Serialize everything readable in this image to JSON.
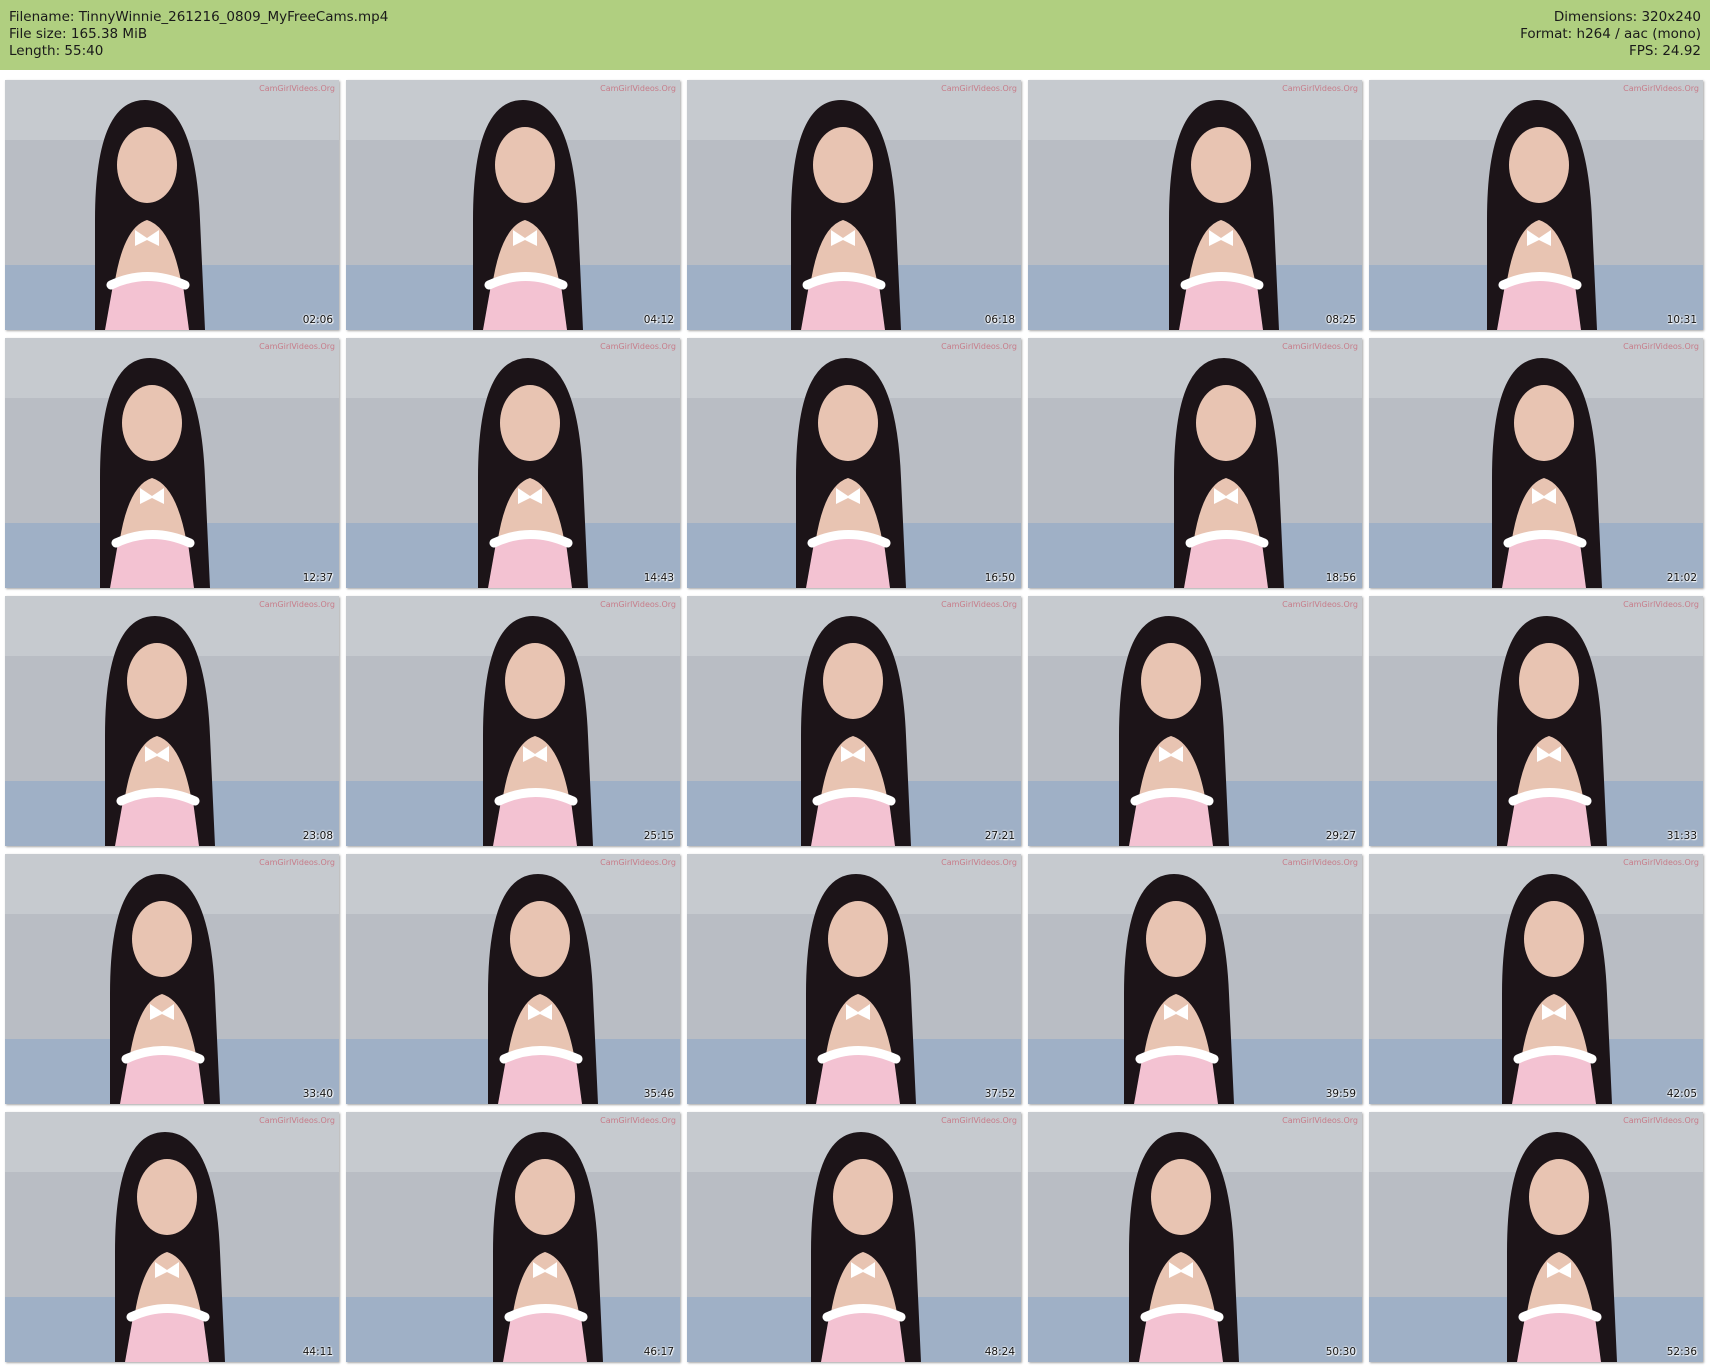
{
  "header": {
    "filename_label": "Filename: ",
    "filename": "TinnyWinnie_261216_0809_MyFreeCams.mp4",
    "filesize_label": "File size: ",
    "filesize": "165.38 MiB",
    "length_label": "Length: ",
    "length": "55:40",
    "dimensions_label": "Dimensions: ",
    "dimensions": "320x240",
    "format_label": "Format: ",
    "format": "h264 / aac (mono)",
    "fps_label": "FPS: ",
    "fps": "24.92"
  },
  "watermark": "CamGirlVideos.Org",
  "thumbnails": [
    {
      "time": "02:06"
    },
    {
      "time": "04:12"
    },
    {
      "time": "06:18"
    },
    {
      "time": "08:25"
    },
    {
      "time": "10:31"
    },
    {
      "time": "12:37"
    },
    {
      "time": "14:43"
    },
    {
      "time": "16:50"
    },
    {
      "time": "18:56"
    },
    {
      "time": "21:02"
    },
    {
      "time": "23:08"
    },
    {
      "time": "25:15"
    },
    {
      "time": "27:21"
    },
    {
      "time": "29:27"
    },
    {
      "time": "31:33"
    },
    {
      "time": "33:40"
    },
    {
      "time": "35:46"
    },
    {
      "time": "37:52"
    },
    {
      "time": "39:59"
    },
    {
      "time": "42:05"
    },
    {
      "time": "44:11"
    },
    {
      "time": "46:17"
    },
    {
      "time": "48:24"
    },
    {
      "time": "50:30"
    },
    {
      "time": "52:36"
    }
  ],
  "colors": {
    "header_bg": "#b0cf80",
    "wall": "#b9bdc4",
    "hair": "#1c1418",
    "skin": "#e8c4b2",
    "outfit": "#f3c2d2",
    "sofa": "#9fb0c6"
  }
}
